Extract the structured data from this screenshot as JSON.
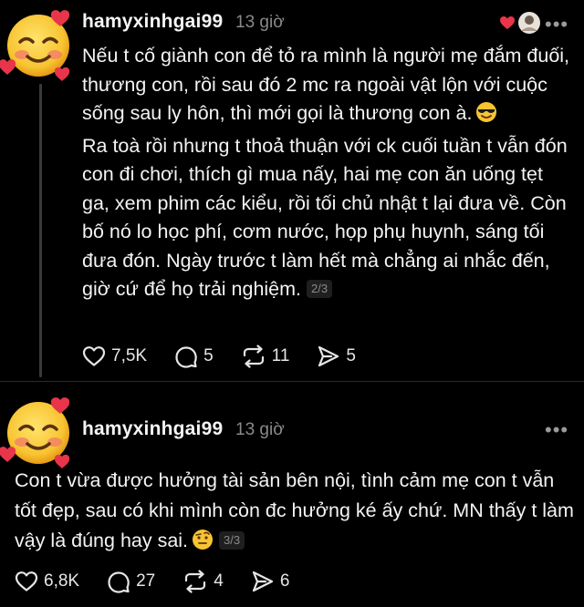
{
  "posts": [
    {
      "username": "hamyxinhgai99",
      "time": "13 giờ",
      "more_label": "•••",
      "paragraph1": "Nếu t cố giành con để tỏ ra mình là người mẹ đắm đuối, thương con, rồi sau đó 2 mc ra ngoài vật lộn với cuộc sống sau ly hôn, thì mới gọi là thương con à.",
      "paragraph2": "Ra toà rồi nhưng t thoả thuận với ck cuối tuần t vẫn đón con đi chơi, thích gì mua nấy, hai mẹ con ăn uống tẹt ga, xem phim các kiểu, rồi tối chủ nhật t lại đưa về. Còn bố nó lo học phí, cơm nước, họp phụ huynh, sáng tối đưa đón. Ngày trước t làm hết mà chẳng ai nhắc đến, giờ cứ để họ trải nghiệm.",
      "pager": "2/3",
      "likes": "7,5K",
      "replies": "5",
      "reposts": "11",
      "shares": "5"
    },
    {
      "username": "hamyxinhgai99",
      "time": "13 giờ",
      "more_label": "•••",
      "paragraph1": "Con t vừa được hưởng tài sản bên nội, tình cảm mẹ con t vẫn tốt đẹp, sau có khi mình còn đc hưởng ké ấy chứ. MN thấy t làm vậy là đúng hay sai.",
      "pager": "3/3",
      "likes": "6,8K",
      "replies": "27",
      "reposts": "4",
      "shares": "6"
    }
  ],
  "icons": {
    "avatar": "smiling-face-with-hearts-icon",
    "like": "heart-outline-icon",
    "reply": "comment-bubble-icon",
    "repost": "repost-arrows-icon",
    "share": "send-arrow-icon"
  },
  "colors": {
    "background": "#000000",
    "text": "#f3f3f3",
    "muted": "#8a8a8a",
    "heart": "#e8354a"
  }
}
